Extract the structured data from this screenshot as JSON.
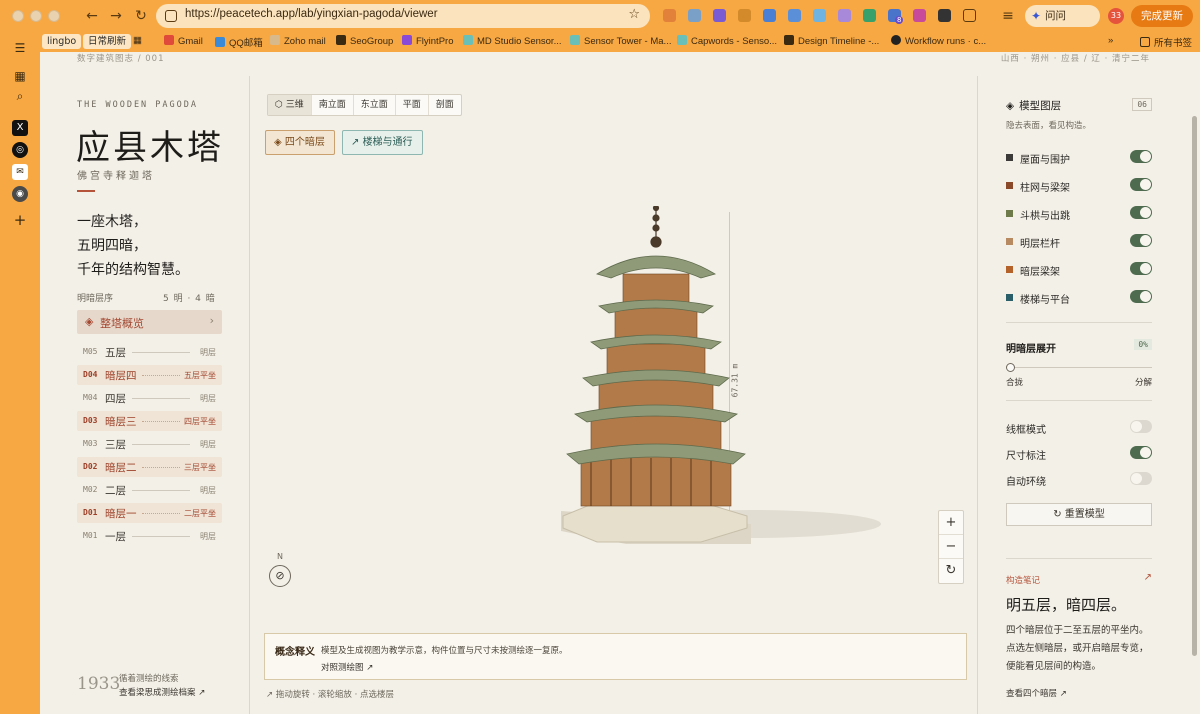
{
  "browser": {
    "url": "https://peacetech.app/lab/yingxian-pagoda/viewer",
    "gemini_label": "问问 Gemini",
    "avatar_count": "33",
    "update_label": "完成更新",
    "ext_badge": "8"
  },
  "bookmarks": {
    "tag1": "lingbo",
    "tag2": "日常刷新",
    "items": [
      "Gmail",
      "QQ邮箱",
      "Zoho mail",
      "SeoGroup",
      "FlyintPro",
      "MD Studio Sensor...",
      "Sensor Tower - Ma...",
      "Capwords - Senso...",
      "Design Timeline -...",
      "Workflow runs · c..."
    ],
    "all_label": "所有书签",
    "more": "»"
  },
  "topline": {
    "left": "数字建筑图志 / 001",
    "right": "山西 · 朔州 · 应县    /    辽 · 清宁二年"
  },
  "left": {
    "eyebrow": "THE WOODEN PAGODA",
    "title": "应县木塔",
    "subtitle": "佛宫寺释迦塔",
    "poem1": "一座木塔，",
    "poem2": "五明四暗，",
    "poem3": "千年的结构智慧。",
    "order_label": "明暗层序",
    "order_value": "5 明 · 4 暗",
    "overview_label": "整塔概览",
    "floors": [
      {
        "code": "M05",
        "name": "五层",
        "tag": "明层"
      },
      {
        "code": "D04",
        "name": "暗层四",
        "tag": "五层平坐"
      },
      {
        "code": "M04",
        "name": "四层",
        "tag": "明层"
      },
      {
        "code": "D03",
        "name": "暗层三",
        "tag": "四层平坐"
      },
      {
        "code": "M03",
        "name": "三层",
        "tag": "明层"
      },
      {
        "code": "D02",
        "name": "暗层二",
        "tag": "三层平坐"
      },
      {
        "code": "M02",
        "name": "二层",
        "tag": "明层"
      },
      {
        "code": "D01",
        "name": "暗层一",
        "tag": "二层平坐"
      },
      {
        "code": "M01",
        "name": "一层",
        "tag": "明层"
      }
    ],
    "year": "1933",
    "footer1": "循着测绘的线索",
    "footer2": "查看梁思成测绘档案 ↗"
  },
  "viewer": {
    "views": [
      "三维",
      "南立面",
      "东立面",
      "平面",
      "剖面"
    ],
    "chip_dark": "四个暗层",
    "chip_stairs": "楼梯与通行",
    "dimension": "67.31 m",
    "compass_n": "N",
    "concept_key": "概念释义",
    "concept_text": "模型及生成视图为教学示意，构件位置与尺寸未按测绘逐一复原。",
    "concept_link": "对照测绘图 ↗",
    "hint": "↗ 拖动旋转 · 滚轮缩放 · 点选楼层"
  },
  "right": {
    "title": "模型图层",
    "badge": "06",
    "sub": "隐去表面，看见构造。",
    "layers": [
      {
        "label": "屋面与围护",
        "color": "#3b3a38",
        "on": true
      },
      {
        "label": "柱网与梁架",
        "color": "#8a4a2a",
        "on": true
      },
      {
        "label": "斗栱与出跳",
        "color": "#6e7a4a",
        "on": true
      },
      {
        "label": "明层栏杆",
        "color": "#b88a62",
        "on": true
      },
      {
        "label": "暗层梁架",
        "color": "#b5612a",
        "on": true
      },
      {
        "label": "楼梯与平台",
        "color": "#2a5f6a",
        "on": true
      }
    ],
    "expand_label": "明暗层展开",
    "expand_value": "0%",
    "slider_left": "合拢",
    "slider_right": "分解",
    "opts": [
      {
        "label": "线框模式",
        "on": false
      },
      {
        "label": "尺寸标注",
        "on": true
      },
      {
        "label": "自动环绕",
        "on": false
      }
    ],
    "reset_label": "↻  重置模型",
    "note_key": "构造笔记",
    "note_title": "明五层，暗四层。",
    "note_body": "四个暗层位于二至五层的平坐内。点选左侧暗层，或开启暗层专览，便能看见层间的构造。",
    "note_link": "查看四个暗层  ↗"
  }
}
